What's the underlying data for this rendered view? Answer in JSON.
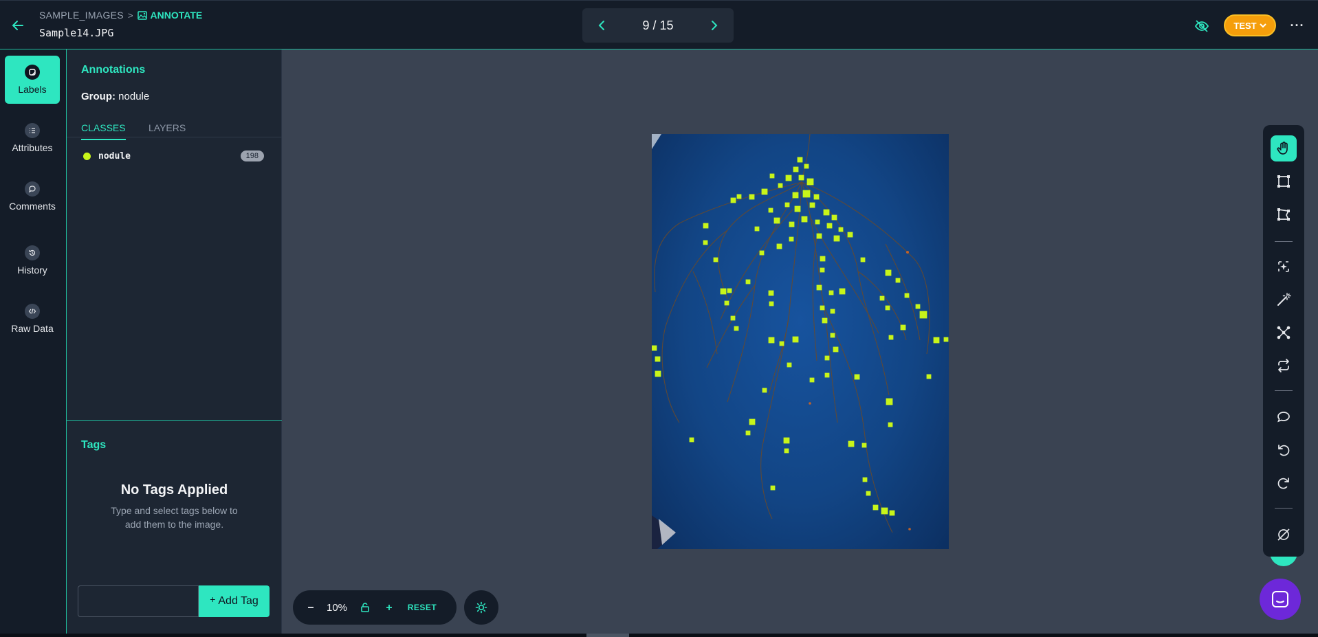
{
  "header": {
    "breadcrumb_root": "SAMPLE_IMAGES",
    "breadcrumb_separator": ">",
    "breadcrumb_current": "ANNOTATE",
    "filename": "Sample14.JPG",
    "pager_text": "9 / 15",
    "mode_button": "TEST"
  },
  "rail": {
    "items": [
      {
        "label": "Labels",
        "icon": "label-icon"
      },
      {
        "label": "Attributes",
        "icon": "list-icon"
      },
      {
        "label": "Comments",
        "icon": "comment-icon"
      },
      {
        "label": "History",
        "icon": "history-icon"
      },
      {
        "label": "Raw Data",
        "icon": "code-icon"
      }
    ]
  },
  "panel": {
    "title": "Annotations",
    "group_label": "Group:",
    "group_value": "nodule",
    "tabs": [
      "CLASSES",
      "LAYERS"
    ],
    "classes": [
      {
        "name": "nodule",
        "count": "198",
        "color": "#c8f51a"
      }
    ]
  },
  "tags": {
    "title": "Tags",
    "empty_title": "No Tags Applied",
    "empty_hint_line1": "Type and select tags below to",
    "empty_hint_line2": "add them to the image.",
    "input_placeholder": "",
    "add_button": "Add Tag"
  },
  "zoom": {
    "level": "10%",
    "reset_label": "RESET"
  },
  "colors": {
    "accent": "#2ee6c0",
    "annotation": "#c8f51a",
    "mode_button": "#f59e0b",
    "chat": "#6d28d9"
  },
  "toolbar": {
    "tools": [
      "pan-hand-icon",
      "bounding-box-icon",
      "polygon-icon",
      "smart-select-icon",
      "magic-wand-icon",
      "keypoint-icon",
      "convert-icon",
      "comment-icon",
      "undo-icon",
      "redo-icon",
      "null-icon"
    ]
  }
}
